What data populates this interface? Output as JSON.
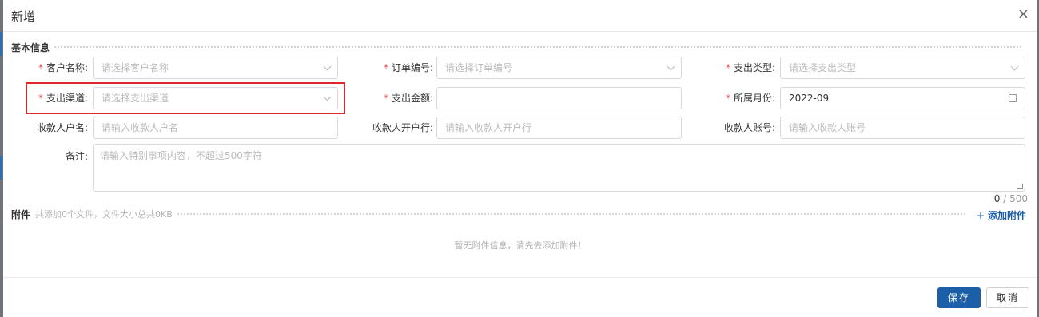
{
  "dialog": {
    "title": "新增",
    "close_icon": "×"
  },
  "basic": {
    "title": "基本信息",
    "fields": {
      "customer": {
        "label": "客户名称:",
        "placeholder": "请选择客户名称"
      },
      "order": {
        "label": "订单编号:",
        "placeholder": "请选择订单编号"
      },
      "expense_type": {
        "label": "支出类型:",
        "placeholder": "请选择支出类型"
      },
      "channel": {
        "label": "支出渠道:",
        "placeholder": "请选择支出渠道"
      },
      "amount": {
        "label": "支出金额:",
        "value": ""
      },
      "month": {
        "label": "所属月份:",
        "value": "2022-09"
      },
      "payee_name": {
        "label": "收款人户名:",
        "placeholder": "请输入收款人户名"
      },
      "payee_bank": {
        "label": "收款人开户行:",
        "placeholder": "请输入收款人开户行"
      },
      "payee_account": {
        "label": "收款人账号:",
        "placeholder": "请输入收款人账号"
      },
      "remark": {
        "label": "备注:",
        "placeholder": "请输入特别事项内容，不超过500字符"
      }
    },
    "required_mark": "*",
    "counter": {
      "current": "0",
      "max": "/ 500"
    }
  },
  "attachments": {
    "title": "附件",
    "summary": "共添加0个文件，文件大小总共0KB",
    "add_label": "添加附件",
    "add_icon": "+",
    "empty_text": "暂无附件信息，请先去添加附件！"
  },
  "footer": {
    "save": "保存",
    "cancel": "取消"
  },
  "colors": {
    "primary": "#1a5fa8",
    "required": "#e5484d",
    "highlight": "#e0262b"
  }
}
